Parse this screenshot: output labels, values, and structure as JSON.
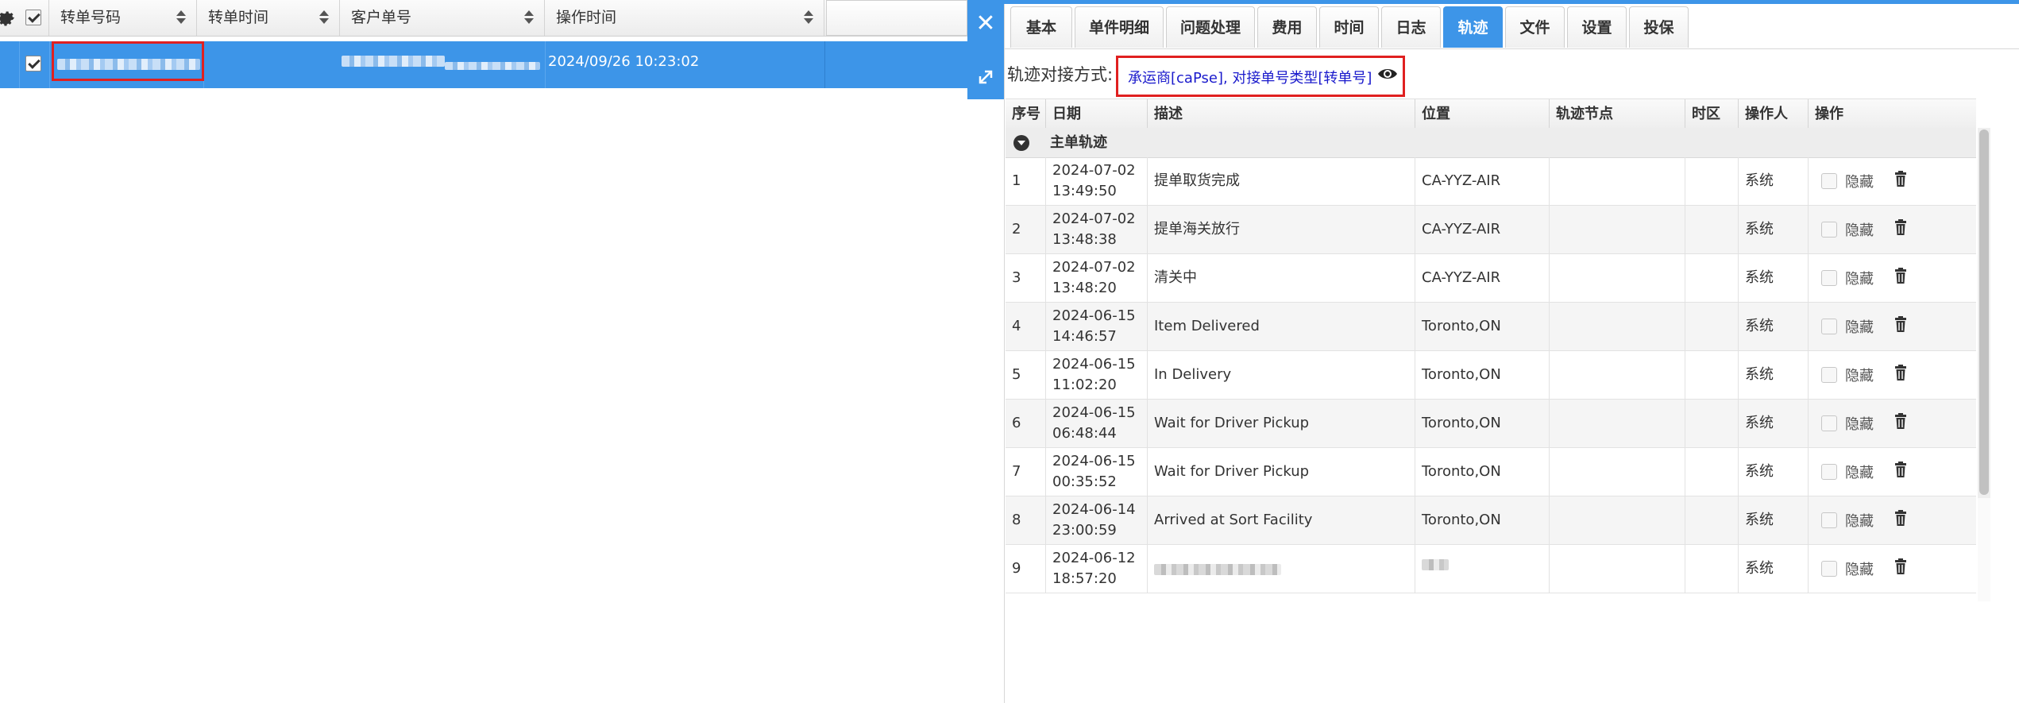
{
  "left_grid": {
    "columns": [
      "转单号码",
      "转单时间",
      "客户单号",
      "操作时间"
    ],
    "selected_row": {
      "operation_time": "2024/09/26 10:23:02"
    }
  },
  "right_panel": {
    "tabs": [
      "基本",
      "单件明细",
      "问题处理",
      "费用",
      "时间",
      "日志",
      "轨迹",
      "文件",
      "设置",
      "投保"
    ],
    "active_tab": "轨迹",
    "track": {
      "label": "轨迹对接方式:",
      "value": "承运商[caPse], 对接单号类型[转单号]"
    },
    "table": {
      "headers": [
        "序号",
        "日期",
        "描述",
        "位置",
        "轨迹节点",
        "时区",
        "操作人",
        "操作"
      ],
      "group": "主单轨迹",
      "hide_label": "隐藏",
      "rows": [
        {
          "no": "1",
          "date": "2024-07-02\n13:49:50",
          "desc": "提单取货完成",
          "loc": "CA-YYZ-AIR",
          "node": "",
          "tz": "",
          "operator": "系统"
        },
        {
          "no": "2",
          "date": "2024-07-02\n13:48:38",
          "desc": "提单海关放行",
          "loc": "CA-YYZ-AIR",
          "node": "",
          "tz": "",
          "operator": "系统"
        },
        {
          "no": "3",
          "date": "2024-07-02\n13:48:20",
          "desc": "清关中",
          "loc": "CA-YYZ-AIR",
          "node": "",
          "tz": "",
          "operator": "系统"
        },
        {
          "no": "4",
          "date": "2024-06-15\n14:46:57",
          "desc": "Item Delivered",
          "loc": "Toronto,ON",
          "node": "",
          "tz": "",
          "operator": "系统"
        },
        {
          "no": "5",
          "date": "2024-06-15\n11:02:20",
          "desc": "In Delivery",
          "loc": "Toronto,ON",
          "node": "",
          "tz": "",
          "operator": "系统"
        },
        {
          "no": "6",
          "date": "2024-06-15\n06:48:44",
          "desc": "Wait for Driver Pickup",
          "loc": "Toronto,ON",
          "node": "",
          "tz": "",
          "operator": "系统"
        },
        {
          "no": "7",
          "date": "2024-06-15\n00:35:52",
          "desc": "Wait for Driver Pickup",
          "loc": "Toronto,ON",
          "node": "",
          "tz": "",
          "operator": "系统"
        },
        {
          "no": "8",
          "date": "2024-06-14\n23:00:59",
          "desc": "Arrived at Sort Facility",
          "loc": "Toronto,ON",
          "node": "",
          "tz": "",
          "operator": "系统"
        },
        {
          "no": "9",
          "date": "2024-06-12\n18:57:20",
          "desc": "",
          "loc": "",
          "node": "",
          "tz": "",
          "operator": "系统"
        }
      ]
    }
  }
}
